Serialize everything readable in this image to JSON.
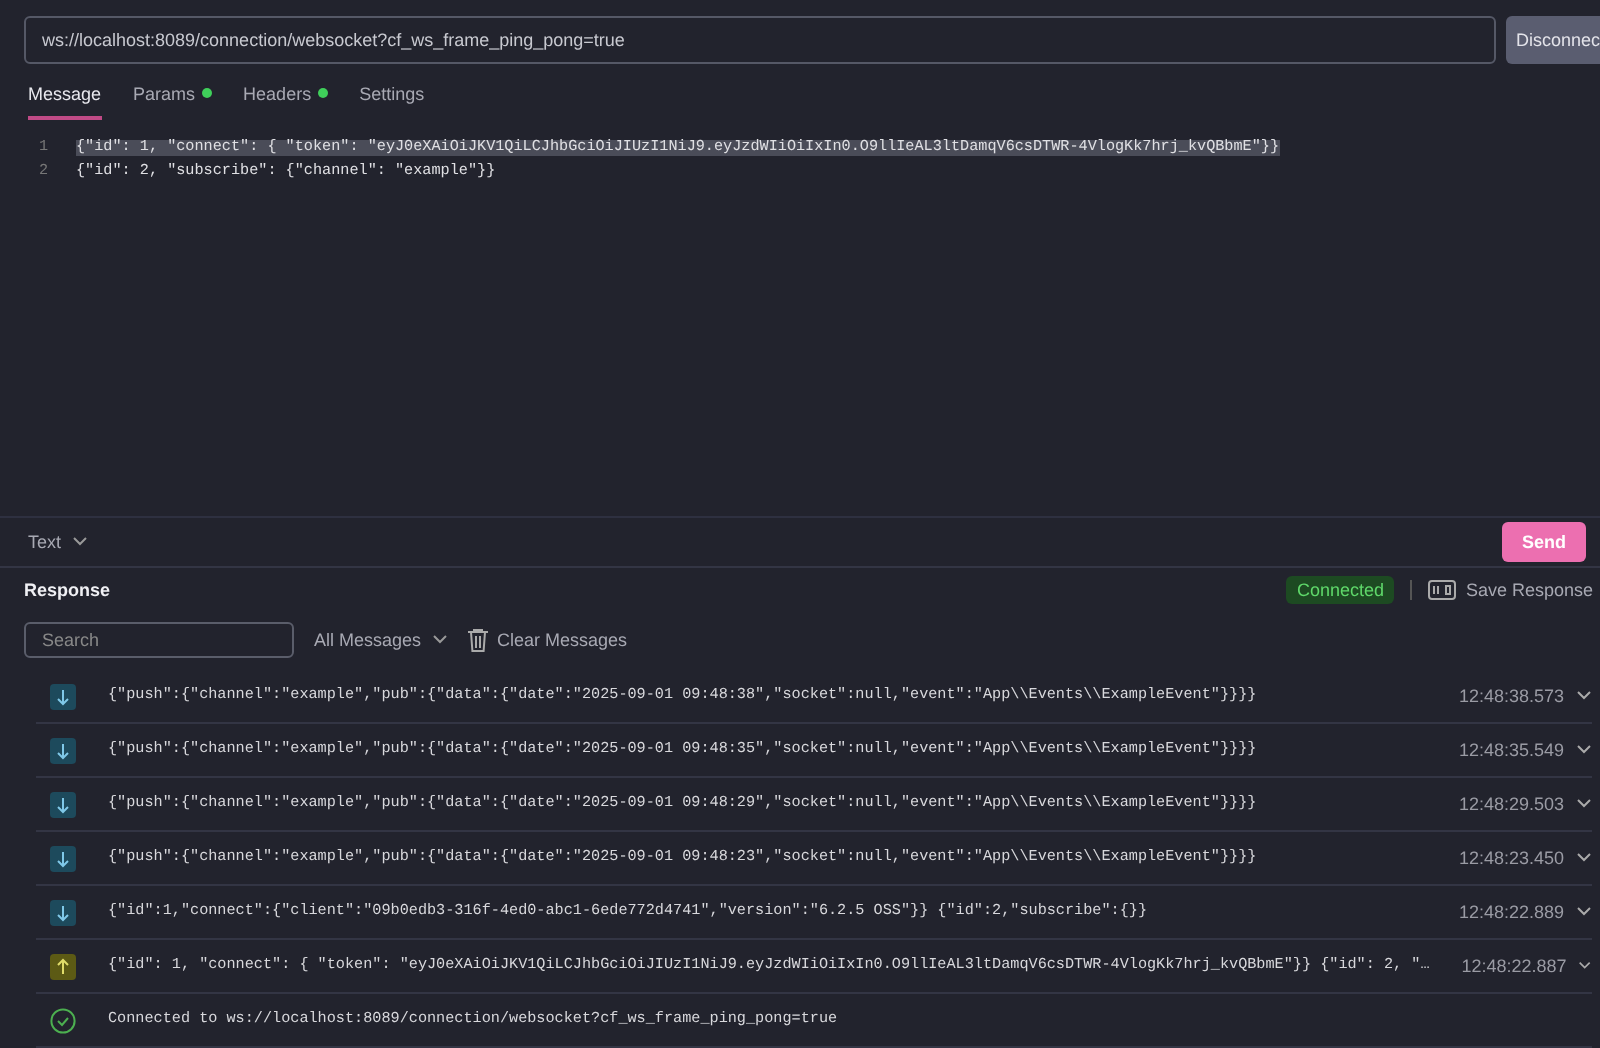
{
  "url_bar": {
    "value": "ws://localhost:8089/connection/websocket?cf_ws_frame_ping_pong=true",
    "button": "Disconnec"
  },
  "tabs": [
    {
      "label": "Message",
      "selected": true,
      "dot": false
    },
    {
      "label": "Params",
      "selected": false,
      "dot": true
    },
    {
      "label": "Headers",
      "selected": false,
      "dot": true
    },
    {
      "label": "Settings",
      "selected": false,
      "dot": false
    }
  ],
  "editor": {
    "lines": [
      {
        "number": "1",
        "text": "{\"id\": 1, \"connect\": { \"token\": \"eyJ0eXAiOiJKV1QiLCJhbGciOiJIUzI1NiJ9.eyJzdWIiOiIxIn0.O9llIeAL3ltDamqV6csDTWR-4VlogKk7hrj_kvQBbmE\"}}",
        "selected": true
      },
      {
        "number": "2",
        "text": "{\"id\": 2, \"subscribe\": {\"channel\": \"example\"}}",
        "selected": false
      }
    ]
  },
  "message_bar": {
    "format": "Text",
    "send": "Send"
  },
  "response": {
    "title": "Response",
    "status": "Connected",
    "save": "Save Response",
    "search_placeholder": "Search",
    "filter": "All Messages",
    "clear": "Clear Messages",
    "messages": [
      {
        "kind": "incoming",
        "text": "{\"push\":{\"channel\":\"example\",\"pub\":{\"data\":{\"date\":\"2025-09-01 09:48:38\",\"socket\":null,\"event\":\"App\\\\Events\\\\ExampleEvent\"}}}}",
        "time": "12:48:38.573"
      },
      {
        "kind": "incoming",
        "text": "{\"push\":{\"channel\":\"example\",\"pub\":{\"data\":{\"date\":\"2025-09-01 09:48:35\",\"socket\":null,\"event\":\"App\\\\Events\\\\ExampleEvent\"}}}}",
        "time": "12:48:35.549"
      },
      {
        "kind": "incoming",
        "text": "{\"push\":{\"channel\":\"example\",\"pub\":{\"data\":{\"date\":\"2025-09-01 09:48:29\",\"socket\":null,\"event\":\"App\\\\Events\\\\ExampleEvent\"}}}}",
        "time": "12:48:29.503"
      },
      {
        "kind": "incoming",
        "text": "{\"push\":{\"channel\":\"example\",\"pub\":{\"data\":{\"date\":\"2025-09-01 09:48:23\",\"socket\":null,\"event\":\"App\\\\Events\\\\ExampleEvent\"}}}}",
        "time": "12:48:23.450"
      },
      {
        "kind": "incoming",
        "text": "{\"id\":1,\"connect\":{\"client\":\"09b0edb3-316f-4ed0-abc1-6ede772d4741\",\"version\":\"6.2.5 OSS\"}} {\"id\":2,\"subscribe\":{}}",
        "time": "12:48:22.889"
      },
      {
        "kind": "outgoing",
        "text": "{\"id\": 1, \"connect\": { \"token\": \"eyJ0eXAiOiJKV1QiLCJhbGciOiJIUzI1NiJ9.eyJzdWIiOiIxIn0.O9llIeAL3ltDamqV6csDTWR-4VlogKk7hrj_kvQBbmE\"}} {\"id\": 2, \"…",
        "time": "12:48:22.887"
      },
      {
        "kind": "info",
        "text": "Connected to ws://localhost:8089/connection/websocket?cf_ws_frame_ping_pong=true"
      }
    ]
  }
}
